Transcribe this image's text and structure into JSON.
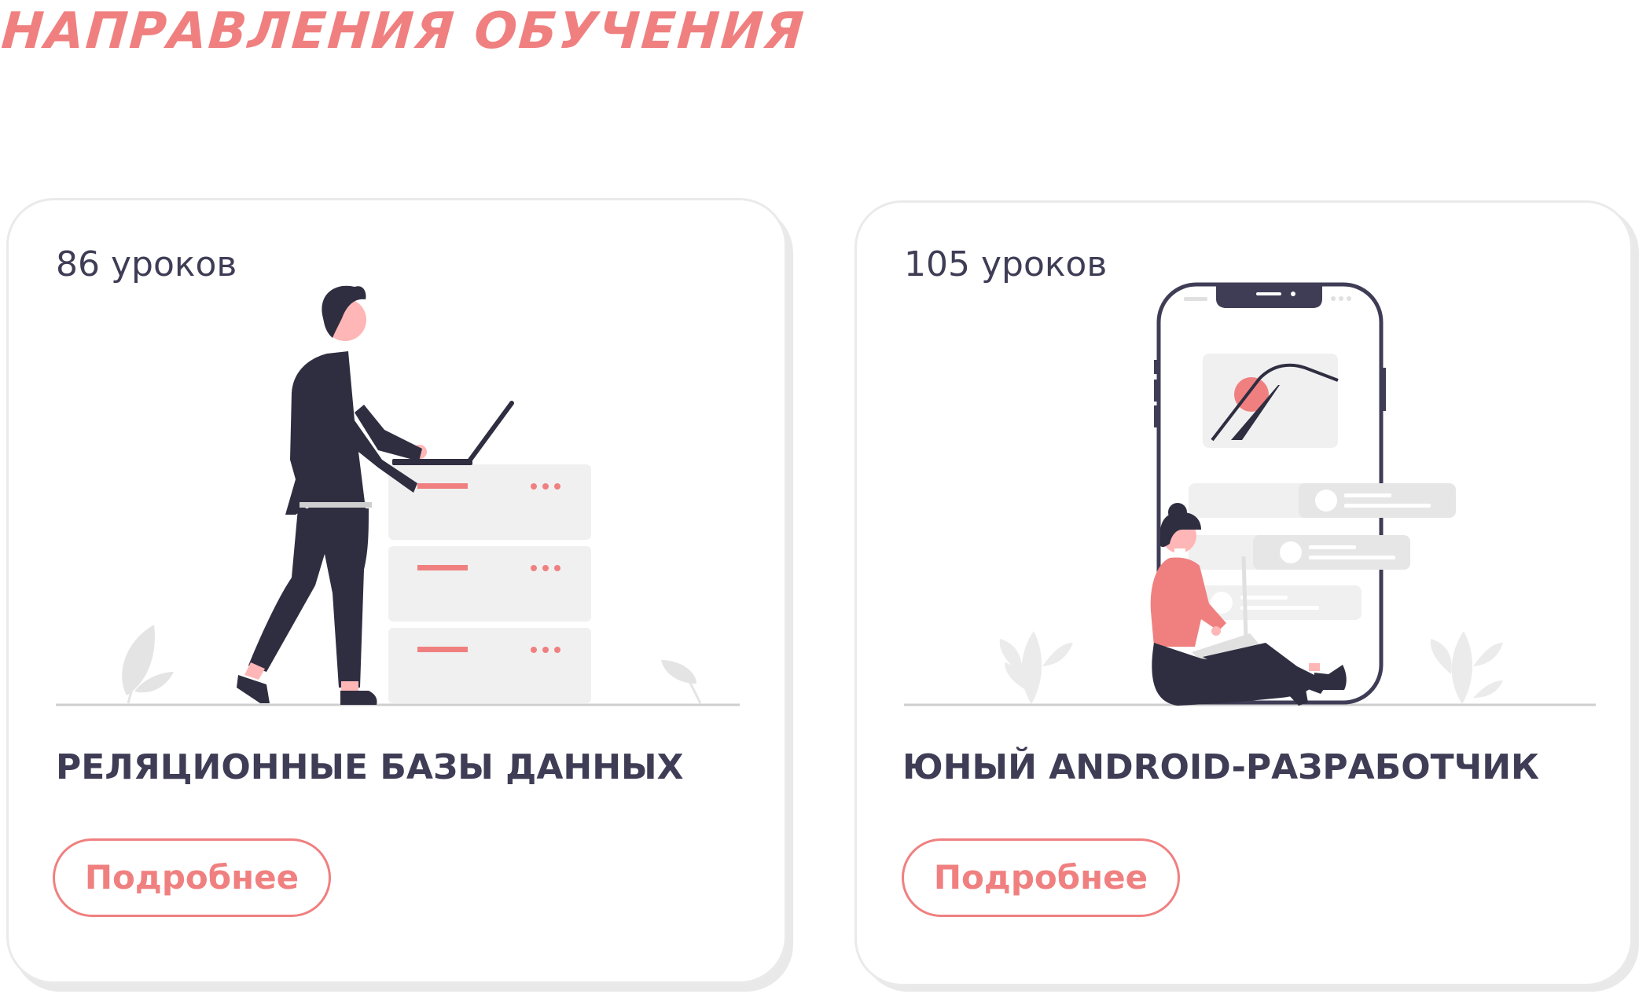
{
  "section": {
    "title": "НАПРАВЛЕНИЯ ОБУЧЕНИЯ"
  },
  "courses": [
    {
      "lessons": "86 уроков",
      "title": "РЕЛЯЦИОННЫЕ БАЗЫ ДАННЫХ",
      "button_label": "Подробнее",
      "illustration": "person-at-server-illustration"
    },
    {
      "lessons": "105 уроков",
      "title": "ЮНЫЙ ANDROID-РАЗРАБОТЧИК",
      "button_label": "Подробнее",
      "illustration": "person-with-phone-illustration"
    }
  ],
  "colors": {
    "accent": "#f08080",
    "dark": "#2f2e41",
    "text": "#3f3d56",
    "light_gray": "#f0f0f0",
    "border": "#eaeaea"
  }
}
